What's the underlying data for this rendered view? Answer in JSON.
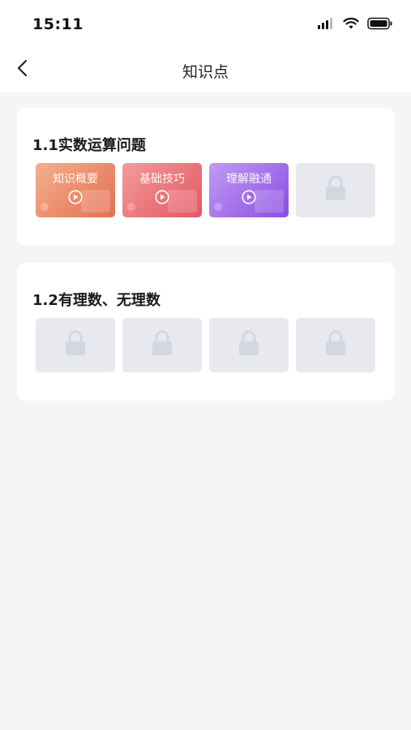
{
  "status_bar": {
    "time": "15:11",
    "icons": [
      "signal-icon",
      "wifi-icon",
      "battery-icon"
    ]
  },
  "nav": {
    "title": "知识点",
    "back_icon": "chevron-left-icon"
  },
  "sections": [
    {
      "title": "1.1实数运算问题",
      "tiles": [
        {
          "label": "知识概要",
          "state": "unlocked",
          "colors": [
            "#f3b08c",
            "#e46f55"
          ],
          "icon": "play-icon"
        },
        {
          "label": "基础技巧",
          "state": "unlocked",
          "colors": [
            "#f29b9a",
            "#e35763"
          ],
          "icon": "play-icon"
        },
        {
          "label": "理解融通",
          "state": "unlocked",
          "colors": [
            "#c19bf3",
            "#8a4ee2"
          ],
          "icon": "play-icon"
        },
        {
          "label": "",
          "state": "locked",
          "icon": "lock-icon"
        }
      ]
    },
    {
      "title": "1.2有理数、无理数",
      "tiles": [
        {
          "label": "",
          "state": "locked",
          "icon": "lock-icon"
        },
        {
          "label": "",
          "state": "locked",
          "icon": "lock-icon"
        },
        {
          "label": "",
          "state": "locked",
          "icon": "lock-icon"
        },
        {
          "label": "",
          "state": "locked",
          "icon": "lock-icon"
        }
      ]
    }
  ],
  "colors": {
    "background": "#f5f5f7",
    "card": "#ffffff",
    "locked_tile": "#e8e9ee",
    "lock": "#d5d7de"
  }
}
